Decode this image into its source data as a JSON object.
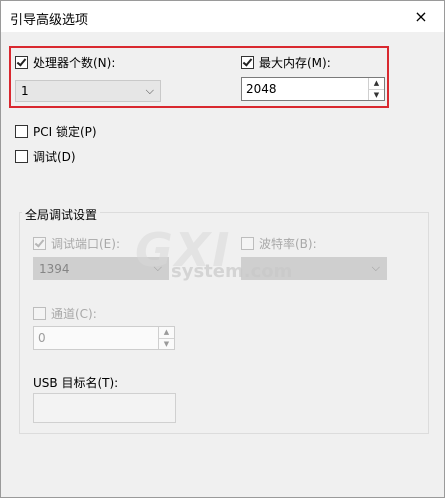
{
  "window": {
    "title": "引导高级选项",
    "close_icon": "×"
  },
  "processor": {
    "label": "处理器个数(N):",
    "checked": true,
    "value": "1"
  },
  "memory": {
    "label": "最大内存(M):",
    "checked": true,
    "value": "2048"
  },
  "pci_lock": {
    "label": "PCI 锁定(P)",
    "checked": false
  },
  "debug": {
    "label": "调试(D)",
    "checked": false
  },
  "global_debug": {
    "title": "全局调试设置",
    "debug_port": {
      "label": "调试端口(E):",
      "checked": true,
      "value": "1394"
    },
    "baud_rate": {
      "label": "波特率(B):",
      "checked": false,
      "value": ""
    },
    "channel": {
      "label": "通道(C):",
      "checked": false,
      "value": "0"
    },
    "usb_target": {
      "label": "USB 目标名(T):",
      "value": ""
    }
  },
  "watermark": {
    "big": "GXI",
    "small": "system.com"
  }
}
